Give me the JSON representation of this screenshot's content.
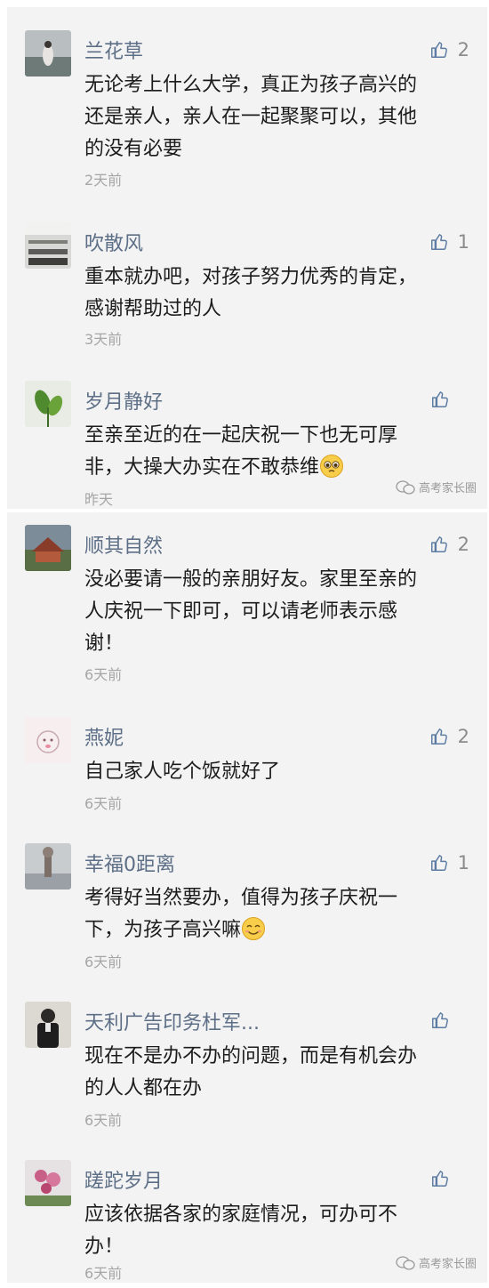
{
  "watermark_text": "高考家长圈",
  "comments": [
    {
      "name": "兰花草",
      "lines": [
        "无论考上什么大学，真正为孩子高兴的",
        "还是亲人，亲人在一起聚聚可以，其他",
        "的没有必要"
      ],
      "time": "2天前",
      "likes": "2",
      "avatar": "avatar-lanhuacao"
    },
    {
      "name": "吹散风",
      "lines": [
        "重本就办吧，对孩子努力优秀的肯定，",
        "感谢帮助过的人"
      ],
      "time": "3天前",
      "likes": "1",
      "avatar": "avatar-chuisanfeng"
    },
    {
      "name": "岁月静好",
      "lines": [
        "至亲至近的在一起庆祝一下也无可厚",
        "非，大操大办实在不敢恭维"
      ],
      "time": "昨天",
      "likes": "",
      "emoji": "pleading-emoji",
      "avatar": "avatar-suiyuejinghao"
    },
    {
      "name": "顺其自然",
      "lines": [
        "没必要请一般的亲朋好友。家里至亲的",
        "人庆祝一下即可，可以请老师表示感",
        "谢！"
      ],
      "time": "6天前",
      "likes": "2",
      "avatar": "avatar-shunqiziran"
    },
    {
      "name": "燕妮",
      "lines": [
        "自己家人吃个饭就好了"
      ],
      "time": "6天前",
      "likes": "2",
      "avatar": "avatar-yanni"
    },
    {
      "name": "幸福0距离",
      "lines": [
        "考得好当然要办，值得为孩子庆祝一",
        "下，为孩子高兴嘛"
      ],
      "time": "6天前",
      "likes": "1",
      "emoji": "smile-emoji",
      "avatar": "avatar-xingfu"
    },
    {
      "name": "天利广告印务杜军...",
      "lines": [
        "现在不是办不办的问题，而是有机会办",
        "的人人都在办"
      ],
      "time": "6天前",
      "likes": "",
      "avatar": "avatar-tianli"
    },
    {
      "name": "蹉跎岁月",
      "lines": [
        "应该依据各家的家庭情况，可办可不",
        "办！"
      ],
      "time": "6天前",
      "likes": "",
      "avatar": "avatar-cuotuosuiyue"
    }
  ]
}
